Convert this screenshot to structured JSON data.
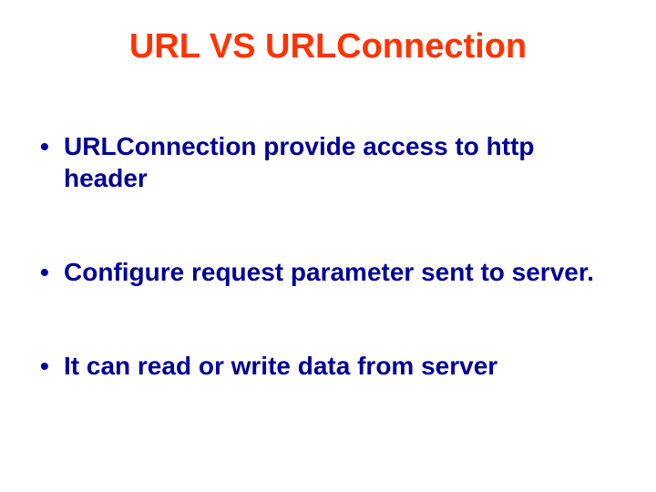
{
  "slide": {
    "title": "URL VS URLConnection",
    "bullets": [
      "URLConnection provide access to http header",
      "Configure request parameter sent to server.",
      "It can read or write data from server"
    ]
  }
}
